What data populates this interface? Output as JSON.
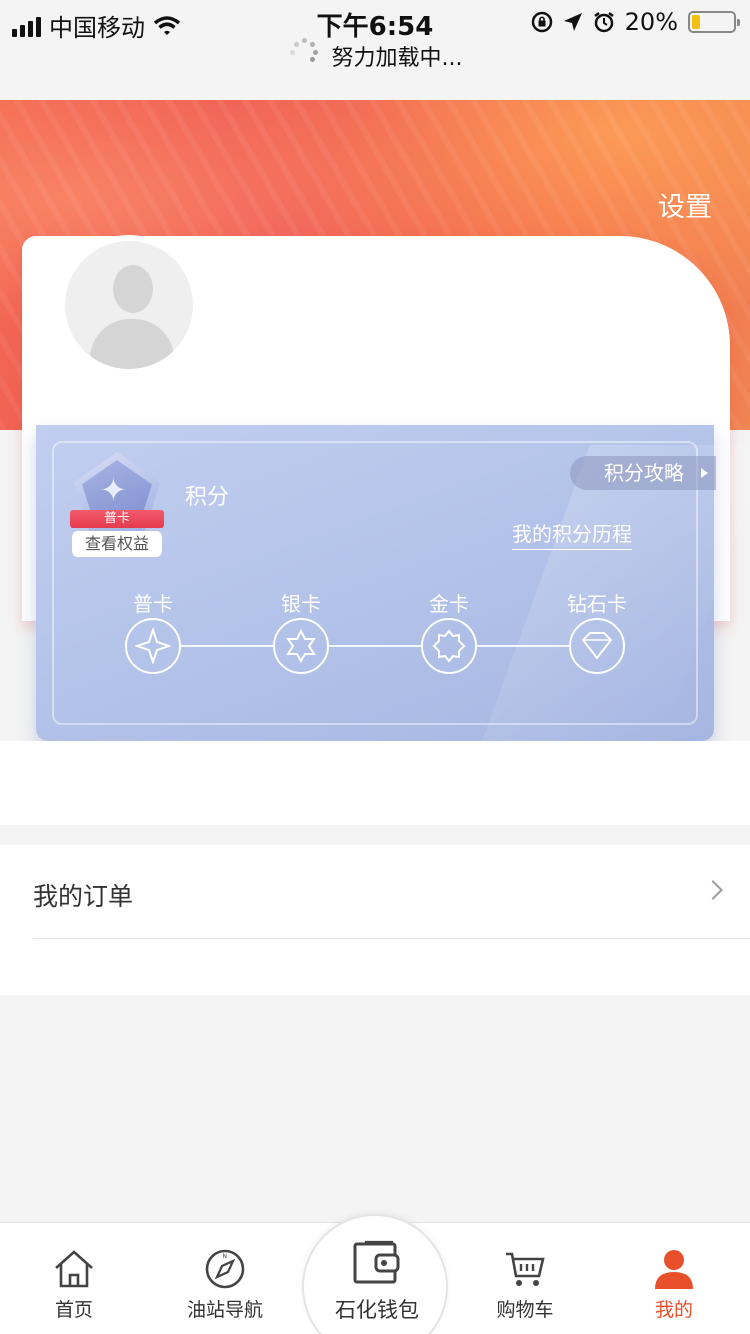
{
  "status_bar": {
    "carrier": "中国移动",
    "time": "下午6:54",
    "battery": "20%",
    "battery_level": 0.2,
    "loading_text": "努力加载中..."
  },
  "header": {
    "settings_label": "设置"
  },
  "member_card": {
    "badge_tier": "普卡",
    "badge_button": "查看权益",
    "points_label": "积分",
    "strategy_label": "积分攻略",
    "history_label": "我的积分历程",
    "tiers": [
      "普卡",
      "银卡",
      "金卡",
      "钻石卡"
    ]
  },
  "sections": {
    "orders_label": "我的订单"
  },
  "tab_bar": {
    "home": "首页",
    "nav": "油站导航",
    "wallet": "石化钱包",
    "cart": "购物车",
    "mine": "我的",
    "active_color": "#e8502c"
  },
  "colors": {
    "accent": "#ef5a54",
    "member_card": "#b6c5ea"
  }
}
